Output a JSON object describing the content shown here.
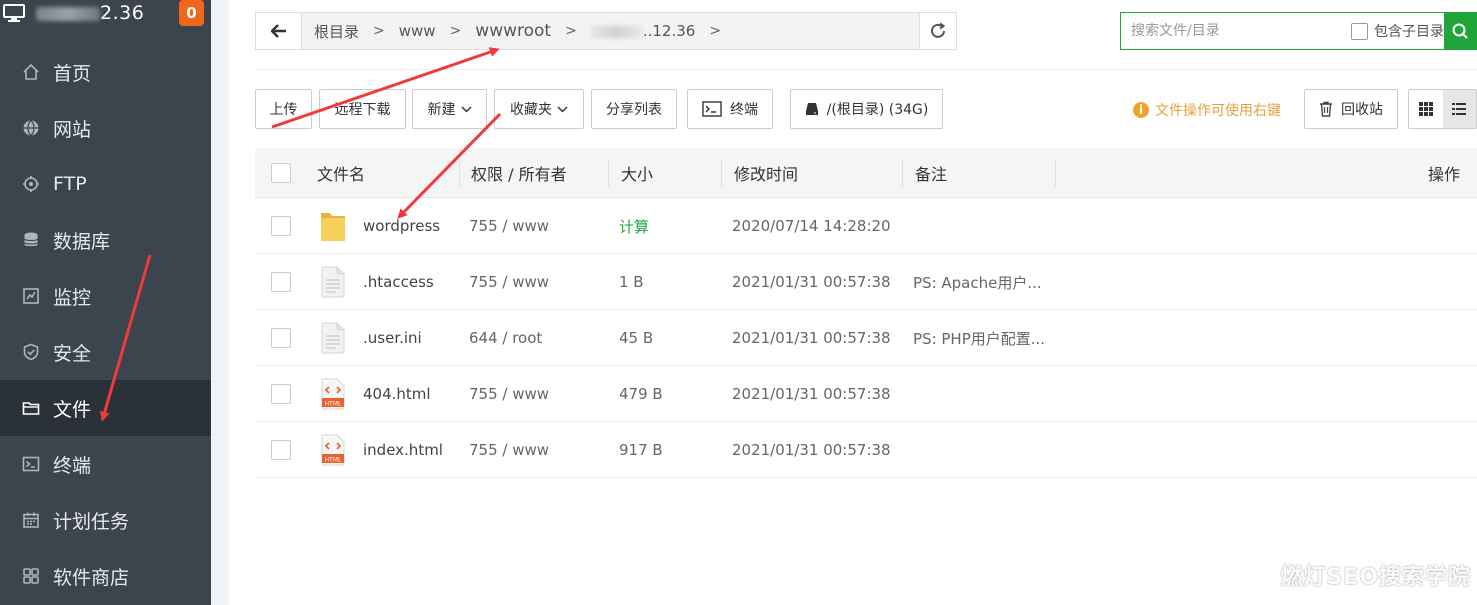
{
  "sidebar": {
    "server_ip_suffix": "2.36",
    "badge_count": "0",
    "items": [
      {
        "label": "首页",
        "icon": "home-icon"
      },
      {
        "label": "网站",
        "icon": "globe-icon"
      },
      {
        "label": "FTP",
        "icon": "ftp-icon"
      },
      {
        "label": "数据库",
        "icon": "database-icon"
      },
      {
        "label": "监控",
        "icon": "monitor-icon"
      },
      {
        "label": "安全",
        "icon": "shield-icon"
      },
      {
        "label": "文件",
        "icon": "folder-icon",
        "active": true
      },
      {
        "label": "终端",
        "icon": "terminal-icon"
      },
      {
        "label": "计划任务",
        "icon": "calendar-icon"
      },
      {
        "label": "软件商店",
        "icon": "apps-icon"
      }
    ]
  },
  "path": {
    "crumbs": [
      "根目录",
      "www",
      "wwwroot",
      "..12.36"
    ]
  },
  "search": {
    "placeholder": "搜索文件/目录",
    "subdir_label": "包含子目录"
  },
  "toolbar": {
    "upload": "上传",
    "remote_download": "远程下载",
    "new": "新建",
    "favorites": "收藏夹",
    "share_list": "分享列表",
    "terminal": "终端",
    "disk": "/(根目录) (34G)",
    "hint": "文件操作可使用右键",
    "recycle": "回收站"
  },
  "table": {
    "headers": {
      "name": "文件名",
      "perm": "权限 / 所有者",
      "size": "大小",
      "mtime": "修改时间",
      "note": "备注",
      "ops": "操作"
    },
    "rows": [
      {
        "type": "folder",
        "name": "wordpress",
        "perm": "755 / www",
        "size": "计算",
        "mtime": "2020/07/14 14:28:20",
        "note": ""
      },
      {
        "type": "text",
        "name": ".htaccess",
        "perm": "755 / www",
        "size": "1 B",
        "mtime": "2021/01/31 00:57:38",
        "note": "PS: Apache用户..."
      },
      {
        "type": "text",
        "name": ".user.ini",
        "perm": "644 / root",
        "size": "45 B",
        "mtime": "2021/01/31 00:57:38",
        "note": "PS: PHP用户配置..."
      },
      {
        "type": "html",
        "name": "404.html",
        "perm": "755 / www",
        "size": "479 B",
        "mtime": "2021/01/31 00:57:38",
        "note": ""
      },
      {
        "type": "html",
        "name": "index.html",
        "perm": "755 / www",
        "size": "917 B",
        "mtime": "2021/01/31 00:57:38",
        "note": ""
      }
    ]
  },
  "watermark": "燃灯SEO搜索学院",
  "colors": {
    "sidebar_bg": "#3c444d",
    "accent_green": "#20a53a",
    "badge_orange": "#f0661a",
    "hint_orange": "#e6a23c",
    "arrow_red": "#f03a3a"
  }
}
